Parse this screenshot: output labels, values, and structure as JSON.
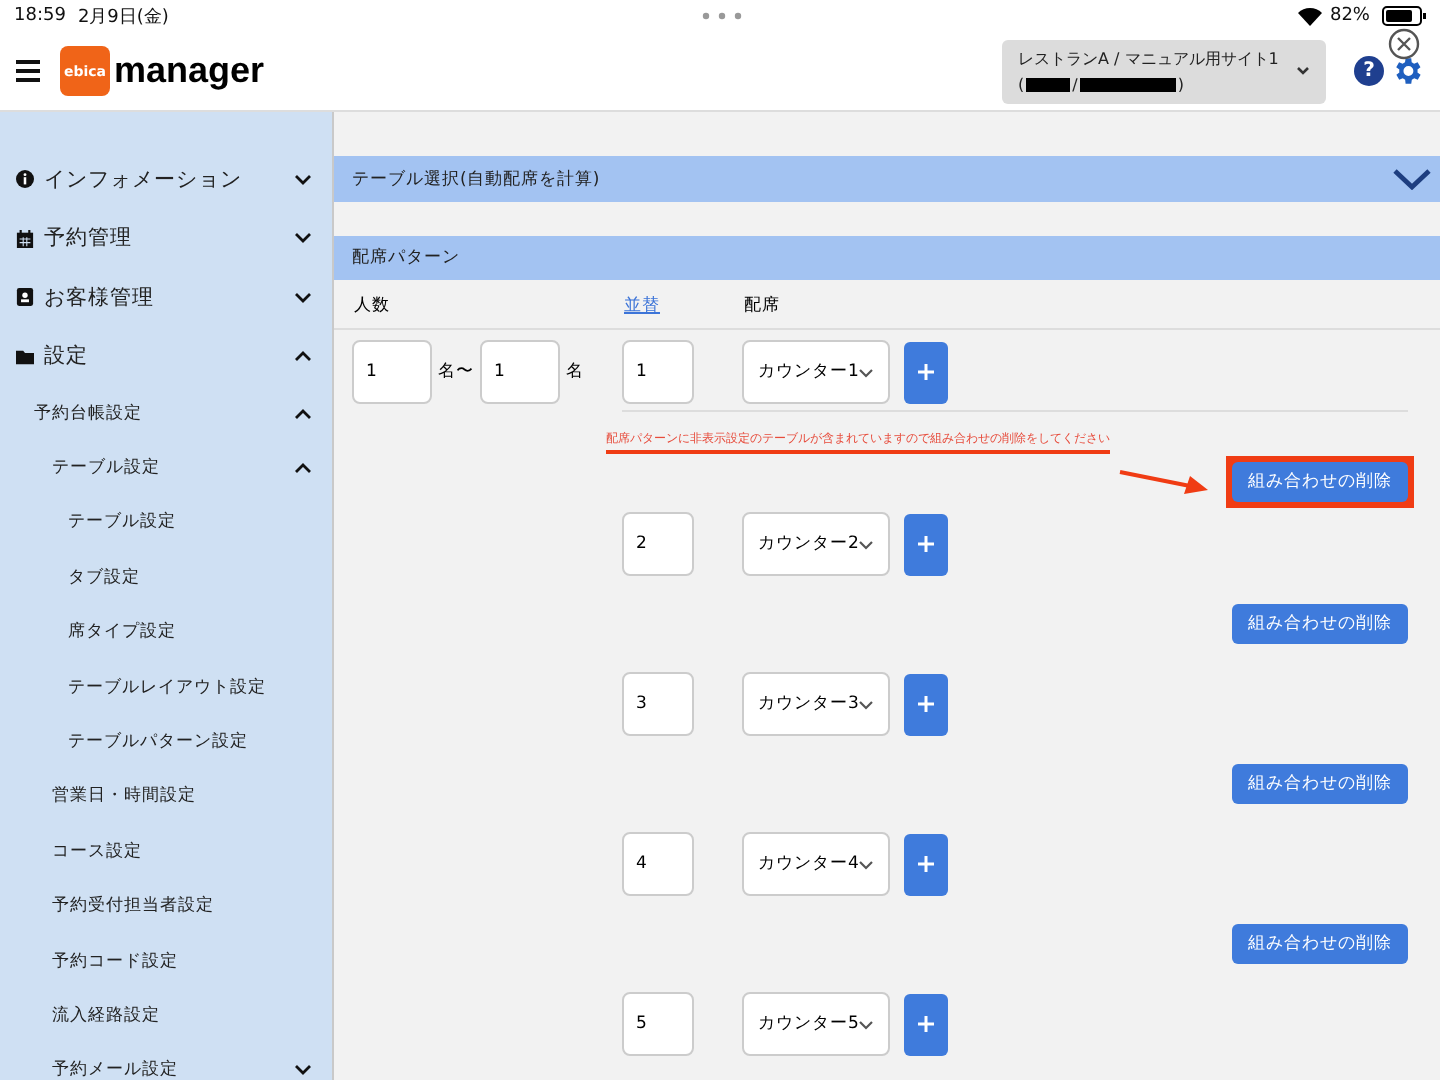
{
  "status_bar": {
    "time": "18:59",
    "date": "2月9日(金)",
    "battery": "82%"
  },
  "header": {
    "logo_badge": "ebica",
    "logo_text": "manager",
    "site_selector": {
      "line1": "レストランA / マニュアル用サイト1",
      "line2_parts": [
        "(",
        "/",
        ")"
      ]
    },
    "help": "?"
  },
  "sidebar": {
    "items": [
      {
        "label": "インフォメーション",
        "expanded": false
      },
      {
        "label": "予約管理",
        "expanded": false
      },
      {
        "label": "お客様管理",
        "expanded": false
      },
      {
        "label": "設定",
        "expanded": true,
        "children": [
          {
            "label": "予約台帳設定",
            "expanded": true,
            "children": [
              {
                "label": "テーブル設定",
                "expanded": true,
                "children": [
                  {
                    "label": "テーブル設定"
                  },
                  {
                    "label": "タブ設定"
                  },
                  {
                    "label": "席タイプ設定"
                  },
                  {
                    "label": "テーブルレイアウト設定"
                  },
                  {
                    "label": "テーブルパターン設定"
                  }
                ]
              },
              {
                "label": "営業日・時間設定"
              },
              {
                "label": "コース設定"
              },
              {
                "label": "予約受付担当者設定"
              },
              {
                "label": "予約コード設定"
              },
              {
                "label": "流入経路設定"
              },
              {
                "label": "予約メール設定",
                "expanded": false
              }
            ]
          }
        ]
      }
    ]
  },
  "table_select_panel": {
    "title": "テーブル選択(自動配席を計算)",
    "expanded": false
  },
  "pattern_panel": {
    "title": "配席パターン",
    "columns": [
      "人数",
      "並替",
      "配席"
    ],
    "party_min": "1",
    "party_unit_range": "名〜",
    "party_max": "1",
    "party_unit": "名",
    "rows": [
      {
        "order": "1",
        "seat": "カウンター1",
        "warning": "配席パターンに非表示設定のテーブルが含まれていますので組み合わせの削除をしてください",
        "delete": "組み合わせの削除",
        "highlighted": true
      },
      {
        "order": "2",
        "seat": "カウンター2",
        "delete": "組み合わせの削除",
        "highlighted": false
      },
      {
        "order": "3",
        "seat": "カウンター3",
        "delete": "組み合わせの削除",
        "highlighted": false
      },
      {
        "order": "4",
        "seat": "カウンター4",
        "delete": "組み合わせの削除",
        "highlighted": false
      },
      {
        "order": "5",
        "seat": "カウンター5"
      }
    ]
  }
}
